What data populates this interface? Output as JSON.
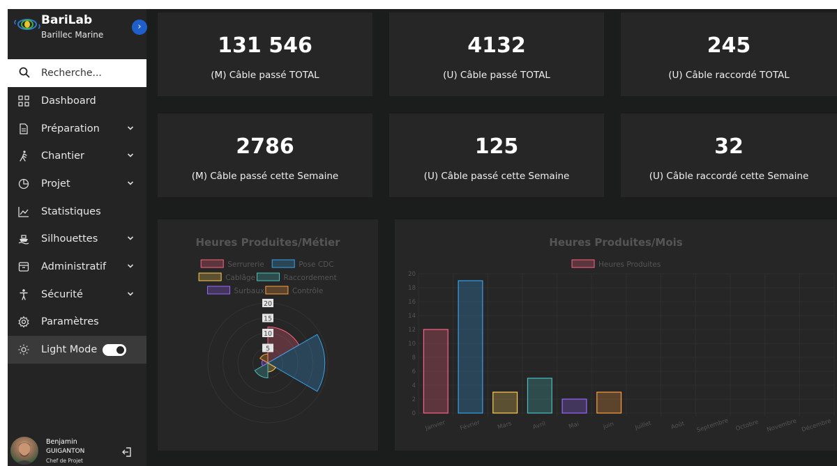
{
  "brand": {
    "title": "BariLab",
    "subtitle": "Barillec Marine"
  },
  "search": {
    "placeholder": "Recherche..."
  },
  "sidebar": {
    "items": [
      {
        "label": "Dashboard",
        "icon": "grid-icon",
        "has_submenu": false
      },
      {
        "label": "Préparation",
        "icon": "document-icon",
        "has_submenu": true
      },
      {
        "label": "Chantier",
        "icon": "walking-person-icon",
        "has_submenu": true
      },
      {
        "label": "Projet",
        "icon": "pie-chart-icon",
        "has_submenu": true
      },
      {
        "label": "Statistiques",
        "icon": "line-chart-icon",
        "has_submenu": false
      },
      {
        "label": "Silhouettes",
        "icon": "ship-icon",
        "has_submenu": true
      },
      {
        "label": "Administratif",
        "icon": "archive-icon",
        "has_submenu": true
      },
      {
        "label": "Sécurité",
        "icon": "person-icon",
        "has_submenu": true
      },
      {
        "label": "Paramètres",
        "icon": "gear-icon",
        "has_submenu": false
      }
    ],
    "light_mode_label": "Light Mode",
    "light_mode_on": true
  },
  "user": {
    "first_name": "Benjamin",
    "last_name": "GUIGANTON",
    "role": "Chef de Projet"
  },
  "stats": [
    {
      "value": "131 546",
      "label": "(M) Câble passé TOTAL"
    },
    {
      "value": "4132",
      "label": "(U) Câble passé TOTAL"
    },
    {
      "value": "245",
      "label": "(U) Câble raccordé TOTAL"
    },
    {
      "value": "2786",
      "label": "(M) Câble passé cette Semaine"
    },
    {
      "value": "125",
      "label": "(U) Câble passé cette Semaine"
    },
    {
      "value": "32",
      "label": "(U) Câble raccordé cette Semaine"
    }
  ],
  "colors": {
    "accent": "#1f5fc9",
    "series": [
      "#ff6384",
      "#36a2eb",
      "#ffce56",
      "#4bc0c0",
      "#9966ff",
      "#ff9f40"
    ]
  },
  "chart_data": [
    {
      "type": "polarArea",
      "title": "Heures Produites/Métier",
      "categories": [
        "Serrurerie",
        "Pose CDC",
        "Cablâge",
        "Raccordement",
        "Surbaux",
        "Contrôle"
      ],
      "values": [
        12,
        19,
        3,
        5,
        2,
        3
      ],
      "ticks": [
        "5",
        "10",
        "15",
        "20"
      ],
      "rmax": 20,
      "legend": "top"
    },
    {
      "type": "bar",
      "title": "Heures Produites/Mois",
      "categories": [
        "Janvier",
        "Février",
        "Mars",
        "Avril",
        "Mai",
        "juin",
        "Juillet",
        "Août",
        "Septembre",
        "Octobre",
        "Novembre",
        "Décembre"
      ],
      "series": [
        {
          "name": "Heures Produites",
          "values": [
            12,
            19,
            3,
            5,
            2,
            3,
            null,
            null,
            null,
            null,
            null,
            null
          ]
        }
      ],
      "yticks": [
        "0",
        "2",
        "4",
        "6",
        "8",
        "10",
        "12",
        "14",
        "16",
        "18",
        "20"
      ],
      "ylim": [
        0,
        20
      ],
      "legend": "top"
    }
  ]
}
